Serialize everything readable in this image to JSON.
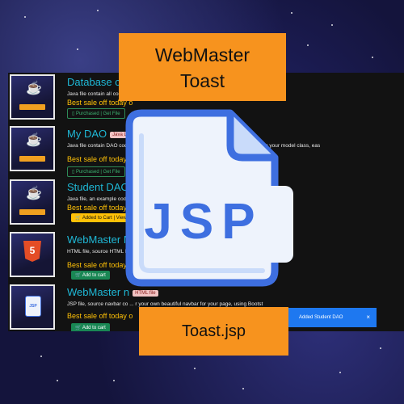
{
  "banner": {
    "title_line1": "WebMaster",
    "title_line2": "Toast",
    "filename": "Toast.jsp"
  },
  "products": [
    {
      "title": "Database co",
      "badge": "",
      "description": "Java file contain all code ... ful to use!",
      "sale": "Best sale off today o",
      "button": "Purchased | Get File",
      "thumb_icon": "java-cup-icon"
    },
    {
      "title": "My DAO",
      "badge": "Java Lo",
      "description": "Java file contain DAO code t ... ext you just need to copy and extend from it and use in your model class, eas",
      "sale": "Best sale off today only",
      "button": "Purchased | Get File",
      "thumb_icon": "java-cup-icon"
    },
    {
      "title": "Student DAO",
      "badge": "",
      "description": "Java file, an example code u",
      "sale": "Best sale off today only",
      "button": "Added to Cart | View Ca",
      "thumb_icon": "java-cup-icon"
    },
    {
      "title": "WebMaster M",
      "badge": "",
      "description": "HTML file, source HTML Ma ... follow these code for your project if you want, using Bootstrap 5",
      "sale": "Best sale off today only",
      "button": "Add to cart",
      "thumb_icon": "html5-icon"
    },
    {
      "title": "WebMaster n",
      "badge": "HTML file",
      "description": "JSP file, source navbar co ... r your own beautiful navbar for your page, using Bootst",
      "sale": "Best sale off today o",
      "button": "Add to cart",
      "thumb_icon": "jsp-file-icon"
    }
  ],
  "toast": {
    "message": "Added Student DAO",
    "close": "×"
  },
  "icon": {
    "name": "jsp-file-icon",
    "text": "JSP"
  },
  "colors": {
    "accent_orange": "#f7931e",
    "title_cyan": "#1fb8d6",
    "sale_yellow": "#ffc107",
    "toast_blue": "#1e78f0",
    "icon_blue": "#3e6fe0"
  }
}
